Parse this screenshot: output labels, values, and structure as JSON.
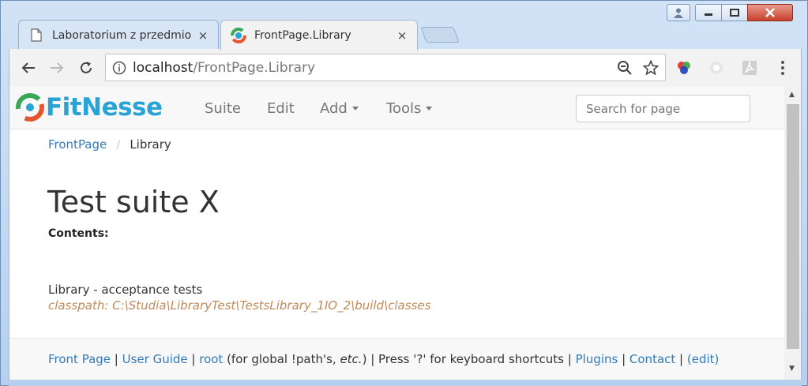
{
  "browser": {
    "tabs": [
      {
        "title": "Laboratorium z przedmio",
        "active": false
      },
      {
        "title": "FrontPage.Library",
        "active": true
      }
    ],
    "tab_close_glyph": "×",
    "url_host": "localhost",
    "url_path": "/FrontPage.Library"
  },
  "navbar": {
    "logo_text": "FitNesse",
    "menu": {
      "suite": "Suite",
      "edit": "Edit",
      "add": "Add",
      "tools": "Tools"
    },
    "search_placeholder": "Search for page"
  },
  "breadcrumb": {
    "items": [
      "FrontPage",
      "Library"
    ],
    "separator": "/"
  },
  "page": {
    "title": "Test suite X",
    "contents_label": "Contents:",
    "description": "Library - acceptance tests",
    "classpath": "classpath: C:\\Studia\\LibraryTest\\TestsLibrary_1IO_2\\build\\classes"
  },
  "footer": {
    "front_page": "Front Page",
    "sep": " | ",
    "user_guide": "User Guide",
    "root": "root",
    "root_note_pre": " (for global !path's, ",
    "root_note_etc": "etc.",
    "root_note_post": ")",
    "keyboard": "Press '?' for keyboard shortcuts",
    "plugins": "Plugins",
    "contact": "Contact",
    "edit": "(edit)"
  },
  "colors": {
    "link": "#337ab7",
    "logo": "#29a3d6",
    "classpath": "#c08a5a"
  }
}
